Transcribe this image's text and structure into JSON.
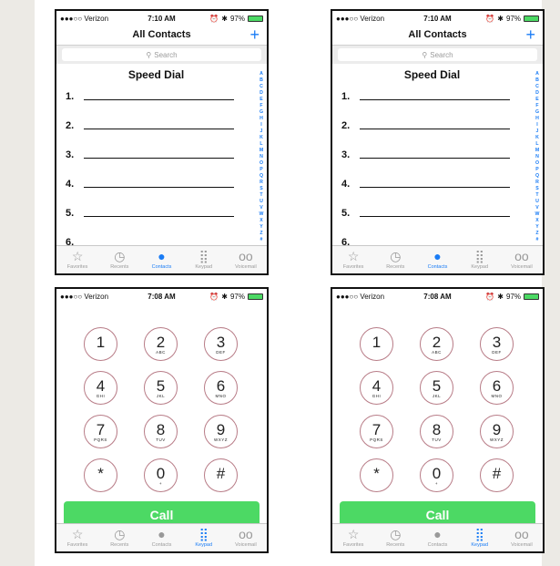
{
  "colors": {
    "accent": "#1a7cf5",
    "call_green": "#4cd964",
    "key_ring": "#b87c87",
    "side_panel": "#eceae5"
  },
  "status": {
    "contacts": {
      "carrier": "●●●○○ Verizon",
      "time": "7:10 AM",
      "battery": "97%",
      "battery_level": 0.97
    },
    "keypad": {
      "carrier": "●●●○○ Verizon",
      "time": "7:08 AM",
      "battery": "97%",
      "battery_level": 0.97
    }
  },
  "contacts": {
    "title": "All Contacts",
    "add_symbol": "+",
    "search_placeholder": "Search",
    "speed_dial_title": "Speed Dial",
    "rows": [
      "1.",
      "2.",
      "3.",
      "4.",
      "5.",
      "6."
    ],
    "index": [
      "A",
      "B",
      "C",
      "D",
      "E",
      "F",
      "G",
      "H",
      "I",
      "J",
      "K",
      "L",
      "M",
      "N",
      "O",
      "P",
      "Q",
      "R",
      "S",
      "T",
      "U",
      "V",
      "W",
      "X",
      "Y",
      "Z",
      "#"
    ]
  },
  "keypad": {
    "keys": [
      {
        "digit": "1",
        "letters": ""
      },
      {
        "digit": "2",
        "letters": "ABC"
      },
      {
        "digit": "3",
        "letters": "DEF"
      },
      {
        "digit": "4",
        "letters": "GHI"
      },
      {
        "digit": "5",
        "letters": "JKL"
      },
      {
        "digit": "6",
        "letters": "MNO"
      },
      {
        "digit": "7",
        "letters": "PQRS"
      },
      {
        "digit": "8",
        "letters": "TUV"
      },
      {
        "digit": "9",
        "letters": "WXYZ"
      },
      {
        "digit": "*",
        "letters": ""
      },
      {
        "digit": "0",
        "letters": "+"
      },
      {
        "digit": "#",
        "letters": ""
      }
    ],
    "call_label": "Call"
  },
  "tabs": [
    {
      "label": "Favorites",
      "icon": "star-icon"
    },
    {
      "label": "Recents",
      "icon": "clock-icon"
    },
    {
      "label": "Contacts",
      "icon": "contacts-icon"
    },
    {
      "label": "Keypad",
      "icon": "keypad-icon"
    },
    {
      "label": "Voicemail",
      "icon": "voicemail-icon"
    }
  ],
  "active_tab": {
    "contacts_screen": "Contacts",
    "keypad_screen": "Keypad"
  }
}
